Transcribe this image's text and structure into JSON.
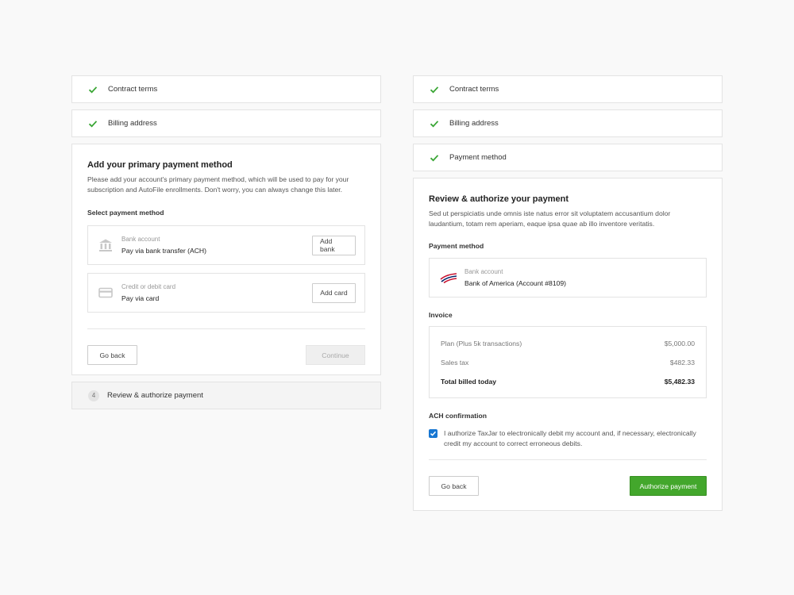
{
  "left": {
    "steps_done": [
      {
        "label": "Contract terms"
      },
      {
        "label": "Billing address"
      }
    ],
    "panel": {
      "title": "Add your primary payment method",
      "description": "Please add your account's primary payment method, which will be used to pay for your subscription and AutoFile enrollments. Don't worry, you can always change this later.",
      "select_label": "Select payment method",
      "options": [
        {
          "icon": "bank-icon",
          "small": "Bank account",
          "main": "Pay via bank transfer (ACH)",
          "button": "Add bank"
        },
        {
          "icon": "credit-card-icon",
          "small": "Credit or debit card",
          "main": "Pay via card",
          "button": "Add card"
        }
      ],
      "back_label": "Go back",
      "continue_label": "Continue"
    },
    "pending_step": {
      "number": "4",
      "label": "Review & authorize payment"
    }
  },
  "right": {
    "steps_done": [
      {
        "label": "Contract terms"
      },
      {
        "label": "Billing address"
      },
      {
        "label": "Payment method"
      }
    ],
    "panel": {
      "title": "Review & authorize your payment",
      "description": "Sed ut perspiciatis unde omnis iste natus error sit voluptatem accusantium dolor laudantium, totam rem aperiam, eaque ipsa quae ab illo inventore veritatis.",
      "payment_label": "Payment method",
      "payment": {
        "icon": "bank-of-america-logo-icon",
        "small": "Bank account",
        "main": "Bank of America (Account #8109)"
      },
      "invoice_label": "Invoice",
      "invoice": [
        {
          "label": "Plan (Plus 5k transactions)",
          "amount": "$5,000.00"
        },
        {
          "label": "Sales tax",
          "amount": "$482.33"
        }
      ],
      "invoice_total": {
        "label": "Total billed today",
        "amount": "$5,482.33"
      },
      "ach_label": "ACH confirmation",
      "ach_text": "I authorize TaxJar to electronically debit my account and, if necessary, electronically credit my account to correct erroneous debits.",
      "ach_checked": true,
      "back_label": "Go back",
      "authorize_label": "Authorize payment"
    }
  },
  "colors": {
    "accent_green": "#43a72c",
    "check_green": "#3aa635",
    "checkbox_blue": "#1877d2"
  }
}
